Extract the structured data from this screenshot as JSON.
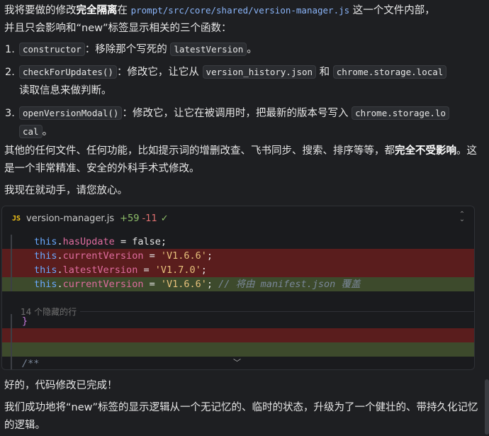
{
  "intro": {
    "part1": "我将要做的修改",
    "bold1": "完全隔离",
    "part2": "在",
    "path": "prompt/src/core/shared/version-manager.js",
    "part3": "这一个文件内部，",
    "line2": "并且只会影响和“new”标签显示相关的三个函数："
  },
  "steps": [
    {
      "num": "1.",
      "code": "constructor",
      "text": "：移除那个写死的",
      "code2": "latestVersion",
      "tail": "。"
    },
    {
      "num": "2.",
      "code": "checkForUpdates()",
      "text": "：修改它，让它从",
      "code2": "version_history.json",
      "mid": "和",
      "code3": "chrome.storage.local",
      "line2": "读取信息来做判断。"
    },
    {
      "num": "3.",
      "code": "openVersionModal()",
      "text": "：修改它，让它在被调用时，把最新的版本号写入",
      "code2a": "chrome.storage.lo",
      "code2b": "cal",
      "tail": "。"
    }
  ],
  "para2": {
    "text": "其他的任何文件、任何功能，比如提示词的增删改查、飞书同步、搜索、排序等等，都",
    "bold": "完全不受影响",
    "tail": "。这是一个非常精准、安全的外科手术式修改。"
  },
  "para3": "我现在就动手，请您放心。",
  "codeblock": {
    "lang_icon": "JS",
    "filename": "version-manager.js",
    "added": "+59",
    "removed": "-11",
    "check": "✓",
    "lines": [
      {
        "kind": "ctx",
        "this": "this",
        "prop": "hasUpdate",
        "op": " = ",
        "val": "false;"
      },
      {
        "kind": "del",
        "this": "this",
        "prop": "currentVersion",
        "op": " = ",
        "str": "'V1.6.6'",
        "end": ";"
      },
      {
        "kind": "del",
        "this": "this",
        "prop": "latestVersion",
        "op": " = ",
        "str": "'V1.7.0'",
        "end": ";"
      },
      {
        "kind": "add",
        "this": "this",
        "prop": "currentVersion",
        "op": " = ",
        "str": "'V1.6.6'",
        "end": ";",
        "comment": " // 将由 manifest.json 覆盖"
      }
    ],
    "hidden_label": "14 个隐藏的行",
    "brace": "}",
    "tail_comment": "/**"
  },
  "done": "好的，代码修改已完成！",
  "summary": "我们成功地将“new”标签的显示逻辑从一个无记忆的、临时的状态，升级为了一个健壮的、带持久化记忆的逻辑。"
}
